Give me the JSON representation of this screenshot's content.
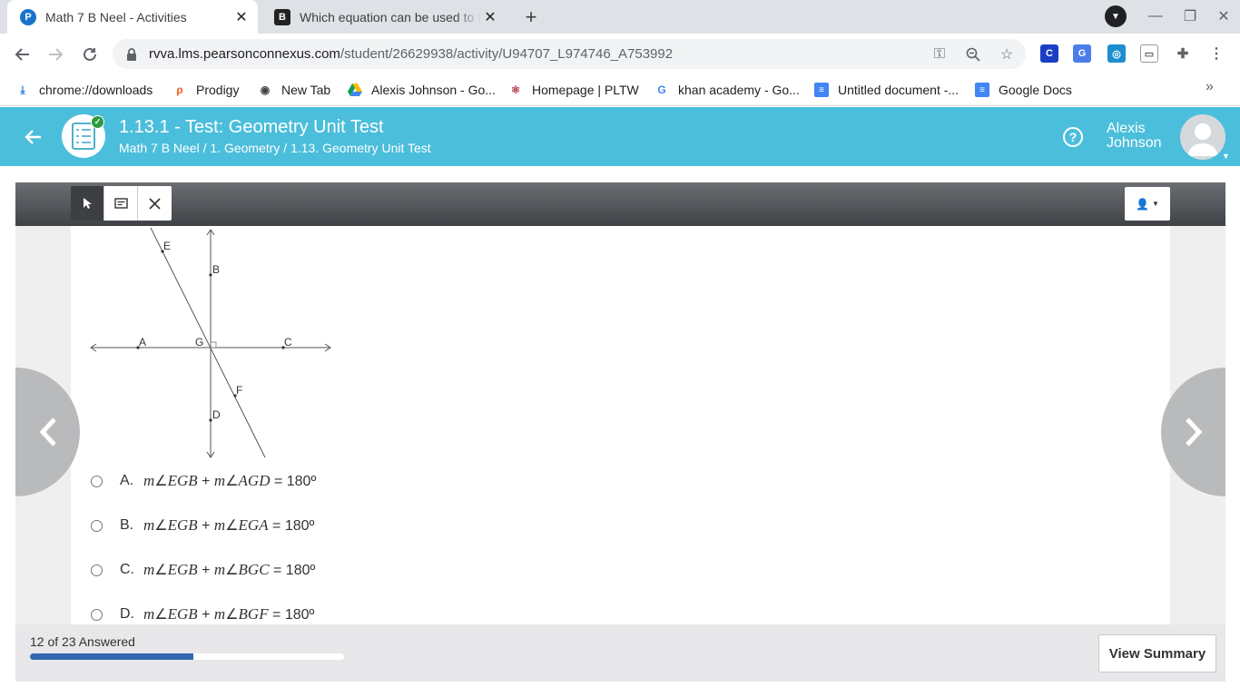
{
  "browser": {
    "tabs": [
      {
        "title": "Math 7 B Neel - Activities",
        "favicon": "P",
        "active": true
      },
      {
        "title": "Which equation can be used to fin",
        "favicon": "B",
        "active": false
      }
    ],
    "url_host": "rvva.lms.pearsonconnexus.com",
    "url_path": "/student/26629938/activity/U94707_L974746_A753992",
    "extensions": [
      "C",
      "G",
      "M",
      "cast",
      "puzzle"
    ],
    "bookmarks": [
      {
        "label": "chrome://downloads",
        "icon": "download-icon"
      },
      {
        "label": "Prodigy",
        "icon": "prodigy-icon"
      },
      {
        "label": "New Tab",
        "icon": "globe-icon"
      },
      {
        "label": "Alexis Johnson - Go...",
        "icon": "drive-icon"
      },
      {
        "label": "Homepage | PLTW",
        "icon": "atom-icon"
      },
      {
        "label": "khan academy - Go...",
        "icon": "google-icon"
      },
      {
        "label": "Untitled document -...",
        "icon": "docs-icon"
      },
      {
        "label": "Google Docs",
        "icon": "docs-icon"
      }
    ]
  },
  "header": {
    "title": "1.13.1 - Test: Geometry Unit Test",
    "breadcrumb": "Math 7 B Neel / 1. Geometry / 1.13. Geometry Unit Test",
    "user_first": "Alexis",
    "user_last": "Johnson"
  },
  "diagram": {
    "points": [
      "E",
      "B",
      "A",
      "G",
      "C",
      "F",
      "D"
    ]
  },
  "options": [
    {
      "letter": "A.",
      "expr_m1": "m",
      "expr_a1": "EGB",
      "plus": "+",
      "expr_m2": "m",
      "expr_a2": "AGD",
      "eq": "= 180º"
    },
    {
      "letter": "B.",
      "expr_m1": "m",
      "expr_a1": "EGB",
      "plus": "+",
      "expr_m2": "m",
      "expr_a2": "EGA",
      "eq": "= 180º"
    },
    {
      "letter": "C.",
      "expr_m1": "m",
      "expr_a1": "EGB",
      "plus": "+",
      "expr_m2": "m",
      "expr_a2": "BGC",
      "eq": "= 180º"
    },
    {
      "letter": "D.",
      "expr_m1": "m",
      "expr_a1": "EGB",
      "plus": "+",
      "expr_m2": "m",
      "expr_a2": "BGF",
      "eq": "= 180º"
    }
  ],
  "footer": {
    "answered_text": "12 of 23 Answered",
    "progress_fraction": 0.52,
    "view_summary_label": "View Summary"
  },
  "colors": {
    "header_bg": "#4bbedb",
    "progress": "#3068b0"
  }
}
